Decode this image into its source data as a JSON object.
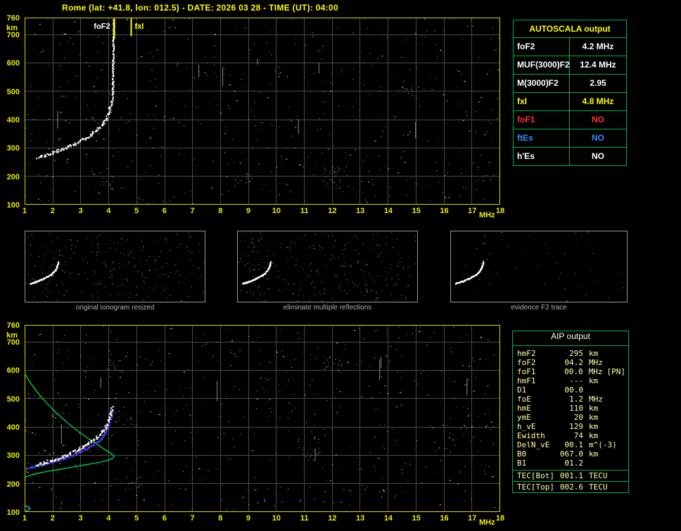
{
  "header": {
    "title": "Rome (lat: +41.8, lon: 012.5) - DATE: 2026 03 28 - TIME (UT): 04:00"
  },
  "colors": {
    "background": "#000000",
    "accent_yellow": "#ffff00",
    "table_border_green": "#00b050",
    "grid_gray": "#4a4a4a",
    "plot_border_yellow": "#d8d800",
    "trace_white": "#ffffff",
    "profile_green": "#00d03c",
    "restored_trace_blue": "#4444ff",
    "e_region_cyan": "#00c0c0",
    "no_red": "#ff3030",
    "ftes_blue": "#2f8fff",
    "caption_gray": "#b0b0b0",
    "aip_text": "#ffffa6"
  },
  "autoscala": {
    "title": "AUTOSCALA output",
    "rows": [
      {
        "label": "foF2",
        "value": "4.2 MHz",
        "color": "#ffffff"
      },
      {
        "label": "MUF(3000)F2",
        "value": "12.4 MHz",
        "color": "#ffffff"
      },
      {
        "label": "M(3000)F2",
        "value": "2.95",
        "color": "#ffffff"
      },
      {
        "label": "fxI",
        "value": "4.8 MHz",
        "color": "#ffff00"
      },
      {
        "label": "foF1",
        "value": "NO",
        "color": "#ff3030"
      },
      {
        "label": "ftEs",
        "value": "NO",
        "color": "#2f8fff"
      },
      {
        "label": "h'Es",
        "value": "NO",
        "color": "#ffffff"
      }
    ]
  },
  "aip": {
    "title": "AIP output",
    "rows": [
      {
        "label": "hmF2",
        "value": "295",
        "unit": "km",
        "extra": ""
      },
      {
        "label": "foF2",
        "value": "04.2",
        "unit": "MHz",
        "extra": ""
      },
      {
        "label": "foF1",
        "value": "00.0",
        "unit": "MHz",
        "extra": "[PN]"
      },
      {
        "label": "hmF1",
        "value": "---",
        "unit": "km",
        "extra": ""
      },
      {
        "label": "D1",
        "value": "00.0",
        "unit": "",
        "extra": ""
      },
      {
        "label": "foE",
        "value": "1.2",
        "unit": "MHz",
        "extra": ""
      },
      {
        "label": "hmE",
        "value": "110",
        "unit": "km",
        "extra": ""
      },
      {
        "label": "ymE",
        "value": "20",
        "unit": "km",
        "extra": ""
      },
      {
        "label": "h_vE",
        "value": "129",
        "unit": "km",
        "extra": ""
      },
      {
        "label": "Ewidth",
        "value": "74",
        "unit": "km",
        "extra": ""
      },
      {
        "label": "DelN_vE",
        "value": "00.1",
        "unit": "m^(-3)",
        "extra": ""
      },
      {
        "label": "B0",
        "value": "067.0",
        "unit": "km",
        "extra": ""
      },
      {
        "label": "B1",
        "value": "01.2",
        "unit": "",
        "extra": ""
      }
    ],
    "tec_rows": [
      {
        "label": "TEC[Bot]",
        "value": "001.1",
        "unit": "TECU"
      },
      {
        "label": "TEC[Top]",
        "value": "002.6",
        "unit": "TECU"
      }
    ]
  },
  "thumbnails": [
    {
      "caption": "original ionogram resized",
      "noise_count": 260,
      "seed": 21
    },
    {
      "caption": "eliminate multiple reflections",
      "noise_count": 300,
      "seed": 22
    },
    {
      "caption": "evidence F2 trace",
      "noise_count": 60,
      "seed": 23
    }
  ],
  "chart_data": [
    {
      "id": "top_ionogram",
      "type": "scatter",
      "title": "ionogram with autoscaled characteristics",
      "xlabel": "MHz",
      "ylabel": "km",
      "xlim": [
        1,
        18
      ],
      "ylim": [
        100,
        760
      ],
      "xticks": [
        1,
        2,
        3,
        4,
        5,
        6,
        7,
        8,
        9,
        10,
        11,
        12,
        13,
        14,
        15,
        16,
        17,
        18
      ],
      "yticks": [
        760,
        700,
        600,
        500,
        400,
        300,
        200,
        100
      ],
      "grid": true,
      "grid_color": "#4a4a4a",
      "noise": {
        "seed": 7,
        "count": 600,
        "clusters": 6,
        "streaks": 7
      },
      "series": [
        {
          "name": "F2-trace",
          "style": "dots",
          "color": "#ffffff",
          "thickness": 2,
          "points": [
            [
              1.45,
              263
            ],
            [
              1.6,
              268
            ],
            [
              1.75,
              272
            ],
            [
              1.9,
              277
            ],
            [
              2.05,
              282
            ],
            [
              2.2,
              287
            ],
            [
              2.35,
              293
            ],
            [
              2.5,
              299
            ],
            [
              2.65,
              305
            ],
            [
              2.8,
              312
            ],
            [
              2.95,
              319
            ],
            [
              3.1,
              327
            ],
            [
              3.25,
              336
            ],
            [
              3.4,
              346
            ],
            [
              3.55,
              357
            ],
            [
              3.7,
              370
            ],
            [
              3.82,
              384
            ],
            [
              3.92,
              399
            ],
            [
              4.0,
              416
            ],
            [
              4.06,
              434
            ],
            [
              4.11,
              452
            ],
            [
              4.14,
              470
            ]
          ]
        },
        {
          "name": "foF2-asymptote",
          "style": "dots",
          "color": "#ffffff",
          "thickness": 1.2,
          "points": [
            [
              4.16,
              480
            ],
            [
              4.17,
              530
            ],
            [
              4.17,
              580
            ],
            [
              4.18,
              630
            ],
            [
              4.18,
              680
            ],
            [
              4.19,
              730
            ],
            [
              4.19,
              752
            ]
          ]
        }
      ],
      "markers": [
        {
          "label": "foF2",
          "x": 4.2,
          "side": "left",
          "color": "#ffff00",
          "label_color": "#ffffff",
          "y_from": 685,
          "y_to": 757
        },
        {
          "label": "fxI",
          "x": 4.8,
          "side": "right",
          "color": "#ffff00",
          "label_color": "#ffff00",
          "y_from": 695,
          "y_to": 757
        }
      ]
    },
    {
      "id": "bottom_ionogram",
      "type": "scatter",
      "title": "restored trace and electron density profile",
      "xlabel": "MHz",
      "ylabel": "km",
      "xlim": [
        1,
        18
      ],
      "ylim": [
        100,
        760
      ],
      "xticks": [
        1,
        2,
        3,
        4,
        5,
        6,
        7,
        8,
        9,
        10,
        11,
        12,
        13,
        14,
        15,
        16,
        17,
        18
      ],
      "yticks": [
        760,
        700,
        600,
        500,
        400,
        300,
        200,
        100
      ],
      "grid": true,
      "grid_color": "#4a4a4a",
      "noise": {
        "seed": 13,
        "count": 620,
        "clusters": 6,
        "streaks": 7
      },
      "series": [
        {
          "name": "electron-density-profile",
          "style": "line",
          "color": "#00d03c",
          "points": [
            [
              1.0,
              588
            ],
            [
              1.2,
              556
            ],
            [
              1.5,
              516
            ],
            [
              1.8,
              482
            ],
            [
              2.1,
              452
            ],
            [
              2.4,
              425
            ],
            [
              2.7,
              400
            ],
            [
              3.0,
              377
            ],
            [
              3.3,
              356
            ],
            [
              3.6,
              337
            ],
            [
              3.85,
              320
            ],
            [
              4.05,
              307
            ],
            [
              4.18,
              298
            ],
            [
              4.2,
              295
            ],
            [
              4.16,
              289
            ],
            [
              4.05,
              283
            ],
            [
              3.85,
              277
            ],
            [
              3.55,
              271
            ],
            [
              3.2,
              265
            ],
            [
              2.85,
              259
            ],
            [
              2.5,
              253
            ],
            [
              2.15,
              247
            ],
            [
              1.8,
              241
            ],
            [
              1.5,
              235
            ],
            [
              1.25,
              229
            ],
            [
              1.08,
              223
            ],
            [
              1.0,
              219
            ],
            [
              0.9,
              196
            ],
            [
              0.85,
              172
            ],
            [
              0.83,
              150
            ]
          ]
        },
        {
          "name": "e-region-profile",
          "style": "line",
          "color": "#00c0c0",
          "points": [
            [
              0.9,
              92
            ],
            [
              1.05,
              100
            ],
            [
              1.15,
              106
            ],
            [
              1.2,
              110
            ],
            [
              1.15,
              115
            ],
            [
              1.03,
              119
            ],
            [
              0.92,
              122
            ]
          ]
        },
        {
          "name": "restored-trace",
          "style": "dots",
          "color": "#4444ff",
          "thickness": 1.6,
          "points": [
            [
              1.05,
              250
            ],
            [
              1.25,
              255
            ],
            [
              1.45,
              260
            ],
            [
              1.65,
              265
            ],
            [
              1.85,
              270
            ],
            [
              2.05,
              276
            ],
            [
              2.25,
              282
            ],
            [
              2.45,
              288
            ],
            [
              2.65,
              295
            ],
            [
              2.85,
              303
            ],
            [
              3.05,
              312
            ],
            [
              3.25,
              322
            ],
            [
              3.45,
              334
            ],
            [
              3.65,
              348
            ],
            [
              3.8,
              362
            ],
            [
              3.9,
              378
            ],
            [
              3.98,
              396
            ],
            [
              4.04,
              416
            ],
            [
              4.09,
              436
            ],
            [
              4.12,
              452
            ]
          ]
        },
        {
          "name": "F2-trace",
          "style": "dots",
          "color": "#ffffff",
          "thickness": 2.4,
          "points": [
            [
              1.45,
              263
            ],
            [
              1.6,
              268
            ],
            [
              1.75,
              272
            ],
            [
              1.9,
              277
            ],
            [
              2.05,
              282
            ],
            [
              2.2,
              287
            ],
            [
              2.35,
              293
            ],
            [
              2.5,
              299
            ],
            [
              2.65,
              305
            ],
            [
              2.8,
              312
            ],
            [
              2.95,
              319
            ],
            [
              3.1,
              327
            ],
            [
              3.25,
              336
            ],
            [
              3.4,
              346
            ],
            [
              3.55,
              357
            ],
            [
              3.7,
              370
            ],
            [
              3.82,
              384
            ],
            [
              3.92,
              399
            ],
            [
              4.0,
              416
            ],
            [
              4.06,
              434
            ],
            [
              4.11,
              452
            ],
            [
              4.14,
              468
            ]
          ]
        }
      ],
      "markers": []
    }
  ]
}
